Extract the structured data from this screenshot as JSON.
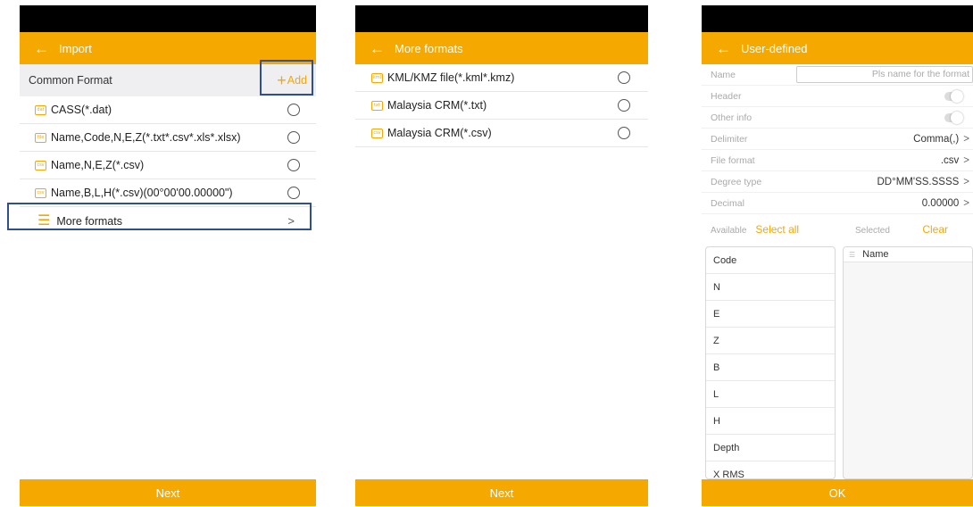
{
  "import_screen": {
    "title": "Import",
    "back_icon": "arrow-left-icon",
    "section_title": "Common Format",
    "add_label": "Add",
    "formats": [
      {
        "icon": "dat",
        "label": "CASS(*.dat)"
      },
      {
        "icon": "file",
        "label": "Name,Code,N,E,Z(*.txt*.csv*.xls*.xlsx)"
      },
      {
        "icon": "csv",
        "label": "Name,N,E,Z(*.csv)"
      },
      {
        "icon": "csv",
        "label": "Name,B,L,H(*.csv)(00°00'00.00000\")"
      }
    ],
    "more_formats_label": "More formats",
    "next_label": "Next"
  },
  "more_formats_screen": {
    "title": "More formats",
    "formats": [
      {
        "icon": "kml",
        "label": "KML/KMZ file(*.kml*.kmz)"
      },
      {
        "icon": "txt",
        "label": "Malaysia CRM(*.txt)"
      },
      {
        "icon": "csv",
        "label": "Malaysia CRM(*.csv)"
      }
    ],
    "next_label": "Next"
  },
  "user_defined_screen": {
    "title": "User-defined",
    "name_label": "Name",
    "name_placeholder": "Pls name for the format",
    "header_label": "Header",
    "other_info_label": "Other info",
    "delimiter_label": "Delimiter",
    "delimiter_value": "Comma(,)",
    "file_format_label": "File format",
    "file_format_value": ".csv",
    "degree_type_label": "Degree type",
    "degree_type_value": "DD°MM'SS.SSSS",
    "decimal_label": "Decimal",
    "decimal_value": "0.00000",
    "available_label": "Available",
    "select_all_label": "Select all",
    "selected_label": "Selected",
    "clear_label": "Clear",
    "available_fields": [
      "Code",
      "N",
      "E",
      "Z",
      "B",
      "L",
      "H",
      "Depth",
      "X RMS"
    ],
    "selected_fields": [
      "Name"
    ],
    "ok_label": "OK"
  },
  "colors": {
    "accent": "#f5a800",
    "highlight_border": "#2f4f8f",
    "status_bar": "#000000",
    "section_bg": "#efeff2"
  }
}
